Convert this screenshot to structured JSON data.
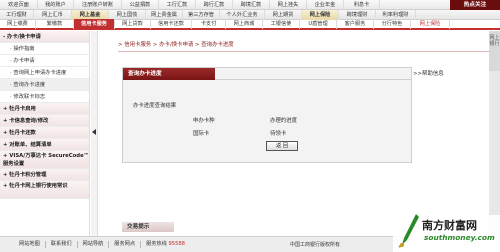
{
  "nav_row1": [
    "欢迎页面",
    "我的账户",
    "注册账户转账",
    "公益捐款",
    "工行汇款",
    "跨行汇款",
    "跨境汇款",
    "网上挂失",
    "企业年金",
    "利息卡"
  ],
  "hot_label": "热点关注",
  "nav_row2": [
    "工行理财",
    "网上汇币",
    "网上基金",
    "网上国债",
    "网上贵金属",
    "第三方存管",
    "个人外汇业务",
    "网上期货",
    "网上保险",
    "跨境理财",
    "利率利理财"
  ],
  "nav_row3": [
    "网上缴费",
    "繁缴款",
    "信用卡服务",
    "网上贷款",
    "信用卡还款",
    "卡支付",
    "网上商城",
    "工银信使",
    "U盾管理",
    "客户服务",
    "分行特色",
    "网上保险"
  ],
  "sidebar": {
    "items": [
      "办卡/换卡申请",
      "操作指南",
      "办卡申请",
      "查询网上申请办卡进度",
      "查询办卡进度",
      "修改联卡标志",
      "牡丹卡启用",
      "卡信息查询/修改",
      "牡丹卡还款",
      "对账单、结算清单",
      "VISA/万事达卡 SecureCode™服务设置",
      "牡丹卡积分管理",
      "牡丹卡网上银行使用常识"
    ]
  },
  "breadcrumb": [
    "信用卡服务",
    "办卡/换卡申请",
    "查询办卡进度"
  ],
  "panel": {
    "title": "查询办卡进度",
    "help": "帮助信息",
    "result_label": "办卡进度查询结果",
    "col_card": "申办卡种",
    "col_status": "办理的进度",
    "card_value": "国际卡",
    "status_value": "待领卡",
    "back_button": "返 回"
  },
  "tx_tip": "交易提示",
  "right_strip_text": "网上银行",
  "footer": {
    "sitemap": "网站地图",
    "contact": "联系我们",
    "shortcuts": "网站导航",
    "service_outlets": "服务网点",
    "hotline_label": "服务热线",
    "hotline_number": "95588",
    "copyright": "中国工商银行版权所有"
  },
  "watermark": {
    "title": "南方财富网",
    "url": "southmoney.com"
  },
  "colors": {
    "brand_red": "#c03030",
    "header_dark": "#6b0d0d",
    "watermark_green": "#2a8a2a"
  }
}
